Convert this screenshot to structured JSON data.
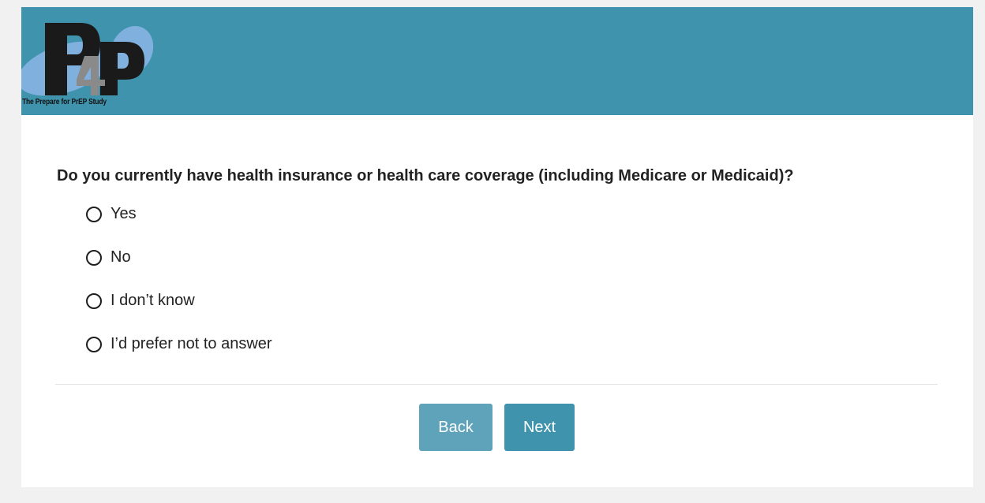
{
  "header": {
    "logo_text": "P4P",
    "logo_caption": "The Prepare for PrEP Study",
    "background_color": "#3f93ad"
  },
  "question": {
    "text": "Do you currently have health insurance or health care coverage (including Medicare or Medicaid)?",
    "options": [
      {
        "label": "Yes",
        "selected": false
      },
      {
        "label": "No",
        "selected": false
      },
      {
        "label": "I don’t know",
        "selected": false
      },
      {
        "label": "I’d prefer not to answer",
        "selected": false
      }
    ]
  },
  "navigation": {
    "back_label": "Back",
    "next_label": "Next",
    "back_color": "#5ea3ba",
    "next_color": "#3f93ad"
  }
}
